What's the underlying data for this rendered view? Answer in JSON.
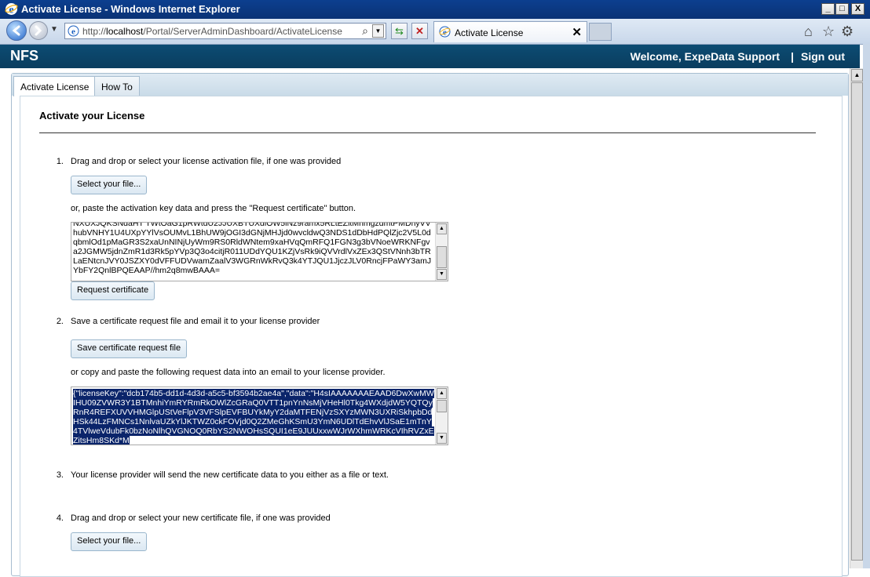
{
  "window": {
    "title": "Activate License - Windows Internet Explorer",
    "minimize": "_",
    "maximize": "□",
    "close": "X"
  },
  "browser": {
    "url_prefix": "http://",
    "url_host": "localhost",
    "url_path": "/Portal/ServerAdminDashboard/ActivateLicense",
    "tab_title": "Activate License",
    "tab_close": "✕"
  },
  "header": {
    "brand": "NFS",
    "welcome": "Welcome, ExpeData Support",
    "separator": "|",
    "signout": "Sign out"
  },
  "tabs": [
    {
      "label": "Activate License",
      "active": true
    },
    {
      "label": "How To",
      "active": false
    }
  ],
  "page": {
    "heading": "Activate your License",
    "steps": [
      {
        "num": "1.",
        "text": "Drag and drop or select your license activation file, if one was provided"
      },
      {
        "num": "2.",
        "text": "Save a certificate request file and email it to your license provider"
      },
      {
        "num": "3.",
        "text": "Your license provider will send the new certificate data to you either as a file or text."
      },
      {
        "num": "4.",
        "text": "Drag and drop or select your new certificate file, if one was provided"
      }
    ],
    "select_file_label": "Select your file...",
    "paste_note": "or, paste the activation key data and press the \"Request certificate\" button.",
    "activation_key_text": "NXUXJQKSNdaHT TWtOaG1pRWtdU2JJUXBTUXdlOW5iNz9ramx5RLtEZitMnmgzdmtPMDhyVVhubVNHY1U4UXpYYlVsOUMvL1BhUW9jOGI3dGNjMHJjd0wvcldwQ3NDS1dDbHdPQlZjc2V5L0dqbmlOd1pMaGR3S2xaUnNINjUyWm9RS0RldWNtem9xaHVqQmRFQ1FGN3g3bVNoeWRKNFgva2JGMW5jdnZmR1d3Rk5pYVp3Q3o4citjR011UDdYQU1KZjVsRk9iQVVrdlVxZEx3QStVNnh3bTRLaENtcnJVY0JSZXY0dVFFUDVwamZaalV3WGRnWkRvQ3k4YTJQU1JjczJLV0RncjFPaWY3amJYbFY2QnlBPQEAAP//hm2q8mwBAAA=",
    "request_cert_label": "Request certificate",
    "save_request_label": "Save certificate request file",
    "copy_note": "or copy and paste the following request data into an email to your license provider.",
    "request_data_text": "{\"licenseKey\":\"dcb174b5-dd1d-4d3d-a5c5-bf3594b2ae4a\",\"data\":\"H4sIAAAAAAAEAAD6DwXwMWIHU09ZVWR3Y1BTMnhiYmRYRmRkOWlZcGRaQ0VTT1pnYnNsMjVHeHl0Tkg4WXdjdW5YQTQyRnR4REFXUVVHMGlpUStVeFlpV3VFSlpEVFBUYkMyY2daMTFENjVzSXYzMWN3UXRiSkhpbDdHSk44LzFMNCs1NnlvaUZkYlJKTWZ0ckFOVjd0Q2ZMeGhKSmU3YmN6UDlTdEhvVlJSaE1mTnY4TVlweVdubFk0bzNoNlhQVGNOQ0RbYS2NWOHsSQUI1eE9JUUxxwWJrWXhmWRKcVIhRVZxEZitsHm8SKd*M"
  },
  "icons": {
    "ie": "ie-logo-icon",
    "back": "back-arrow-icon",
    "forward": "forward-arrow-icon",
    "search": "search-icon",
    "refresh": "refresh-icon",
    "stop": "stop-icon",
    "home": "home-icon",
    "favorites": "star-icon",
    "tools": "gear-icon"
  }
}
